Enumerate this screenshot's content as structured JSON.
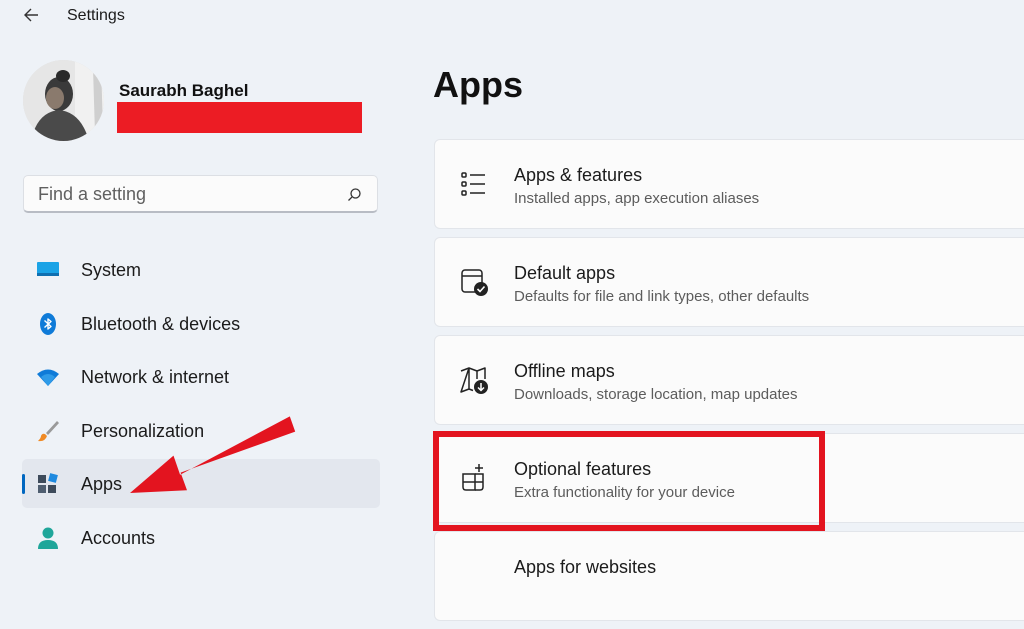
{
  "window": {
    "title": "Settings"
  },
  "user": {
    "name": "Saurabh Baghel"
  },
  "search": {
    "placeholder": "Find a setting"
  },
  "sidebar": {
    "items": [
      {
        "label": "System",
        "icon": "system-icon",
        "selected": false
      },
      {
        "label": "Bluetooth & devices",
        "icon": "bluetooth-icon",
        "selected": false
      },
      {
        "label": "Network & internet",
        "icon": "wifi-icon",
        "selected": false
      },
      {
        "label": "Personalization",
        "icon": "brush-icon",
        "selected": false
      },
      {
        "label": "Apps",
        "icon": "apps-icon",
        "selected": true
      },
      {
        "label": "Accounts",
        "icon": "account-icon",
        "selected": false
      }
    ]
  },
  "main": {
    "title": "Apps",
    "cards": [
      {
        "title": "Apps & features",
        "subtitle": "Installed apps, app execution aliases",
        "icon": "list-icon"
      },
      {
        "title": "Default apps",
        "subtitle": "Defaults for file and link types, other defaults",
        "icon": "default-apps-icon"
      },
      {
        "title": "Offline maps",
        "subtitle": "Downloads, storage location, map updates",
        "icon": "map-download-icon"
      },
      {
        "title": "Optional features",
        "subtitle": "Extra functionality for your device",
        "icon": "grid-add-icon"
      },
      {
        "title": "Apps for websites",
        "subtitle": "",
        "icon": ""
      }
    ]
  },
  "colors": {
    "accent": "#0067c0",
    "annotation": "#e3141f",
    "redaction": "#ec1c24",
    "background": "#eef2f7"
  }
}
